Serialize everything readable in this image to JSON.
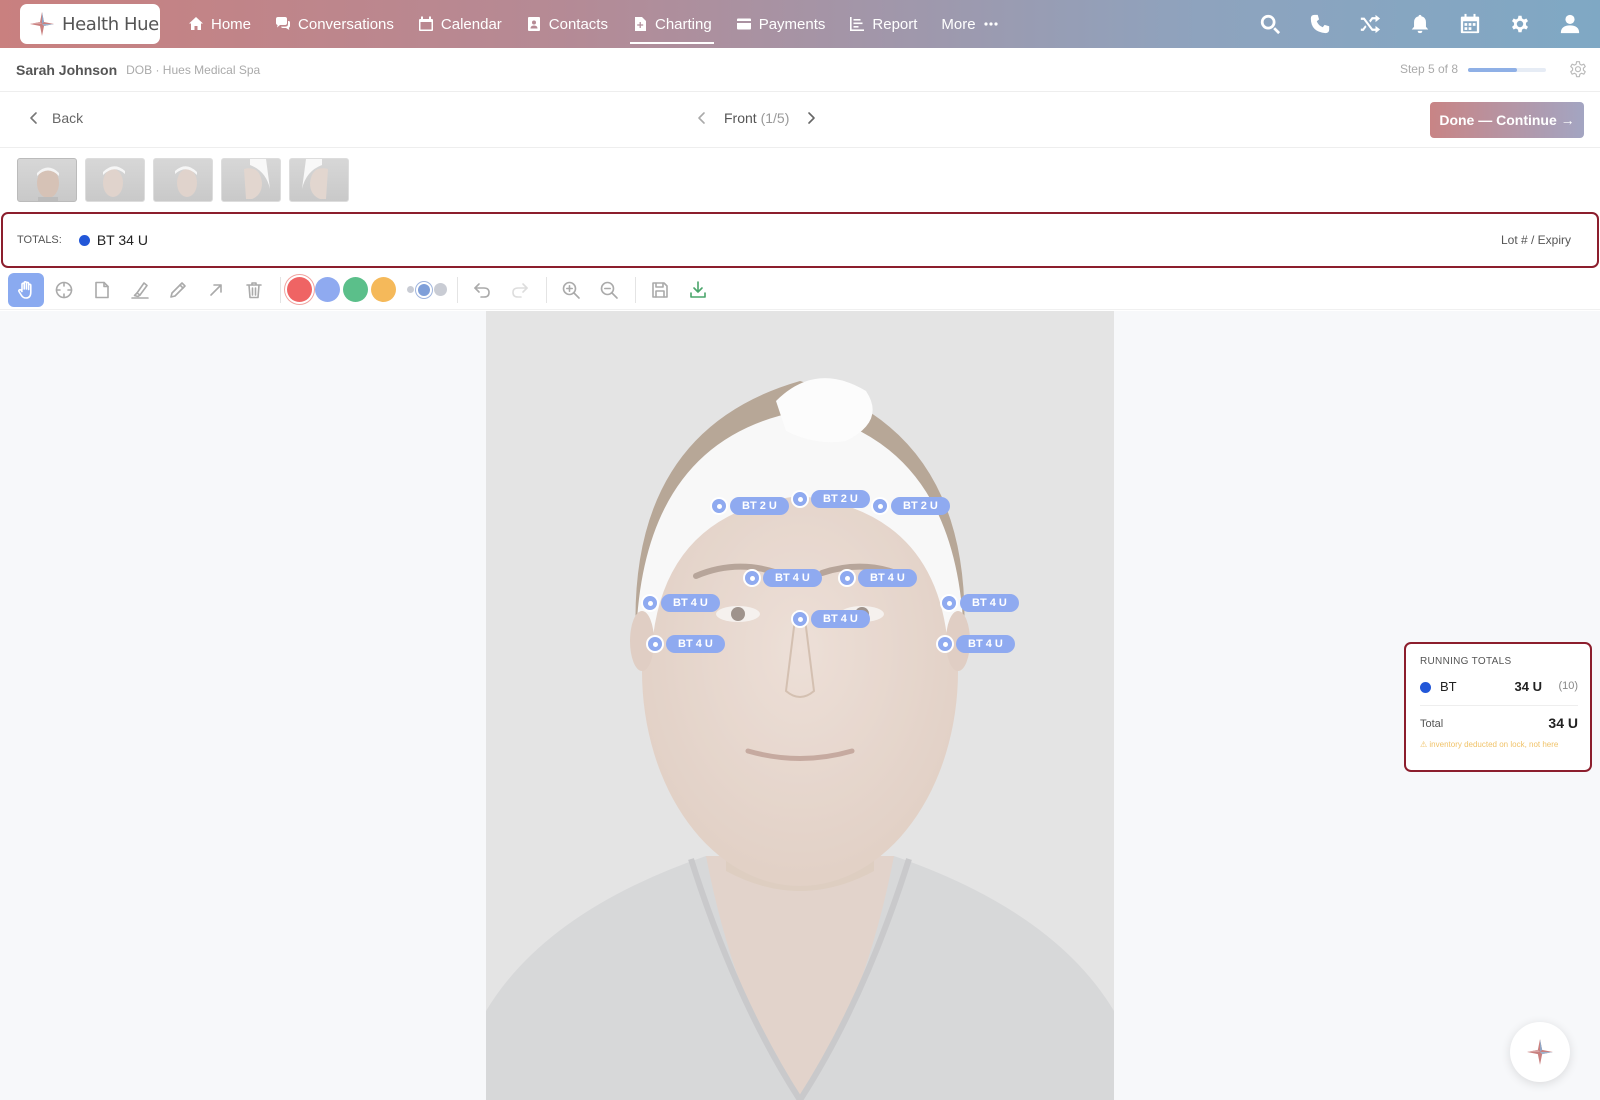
{
  "app": {
    "name": "Health Hue"
  },
  "nav": {
    "items": [
      {
        "label": "Home",
        "icon": "home-icon"
      },
      {
        "label": "Conversations",
        "icon": "chat-icon"
      },
      {
        "label": "Calendar",
        "icon": "calendar-icon"
      },
      {
        "label": "Contacts",
        "icon": "contact-card-icon"
      },
      {
        "label": "Charting",
        "icon": "document-plus-icon",
        "active": true
      },
      {
        "label": "Payments",
        "icon": "credit-card-icon"
      },
      {
        "label": "Report",
        "icon": "bar-chart-icon"
      },
      {
        "label": "More",
        "icon": "ellipsis-icon"
      }
    ],
    "right_icons": [
      "search-icon",
      "phone-icon",
      "shuffle-icon",
      "bell-icon",
      "calendar-grid-icon",
      "gear-icon",
      "user-icon"
    ]
  },
  "patient": {
    "name": "Sarah Johnson",
    "meta": "DOB · Hues Medical Spa",
    "step": "Step 5 of 8",
    "step_progress": 0.625
  },
  "chart_nav": {
    "back": "Back",
    "view": "Front",
    "view_count": "(1/5)",
    "done_button": "Done — Continue →"
  },
  "thumbnails": [
    "front",
    "left-oblique",
    "right-oblique",
    "left-profile",
    "right-profile"
  ],
  "totals": {
    "label": "TOTALS:",
    "value": "BT 34 U",
    "lot_link": "Lot # / Expiry",
    "dot_color": "#2257d8"
  },
  "toolbar": {
    "tools": [
      "hand-icon",
      "crosshair-icon",
      "note-icon",
      "highlighter-icon",
      "pencil-icon",
      "arrow-icon",
      "trash-icon"
    ],
    "colors": [
      "#ef6464",
      "#8faaf0",
      "#5bbf8a",
      "#f5b95a"
    ],
    "selected_color": 0,
    "actions": [
      "undo-icon",
      "redo-icon",
      "zoom-in-icon",
      "zoom-out-icon",
      "save-icon",
      "download-icon"
    ]
  },
  "injections": [
    {
      "label": "BT 2 U"
    },
    {
      "label": "BT 2 U"
    },
    {
      "label": "BT 2 U"
    },
    {
      "label": "BT 4 U"
    },
    {
      "label": "BT 4 U"
    },
    {
      "label": "BT 4 U"
    },
    {
      "label": "BT 4 U"
    },
    {
      "label": "BT 4 U"
    },
    {
      "label": "BT 4 U"
    },
    {
      "label": "BT 4 U"
    }
  ],
  "running_totals": {
    "title": "RUNNING TOTALS",
    "product": "BT",
    "units": "34 U",
    "count": "(10)",
    "total_label": "Total",
    "total_value": "34 U",
    "warning": "⚠ inventory deducted on lock, not here"
  }
}
